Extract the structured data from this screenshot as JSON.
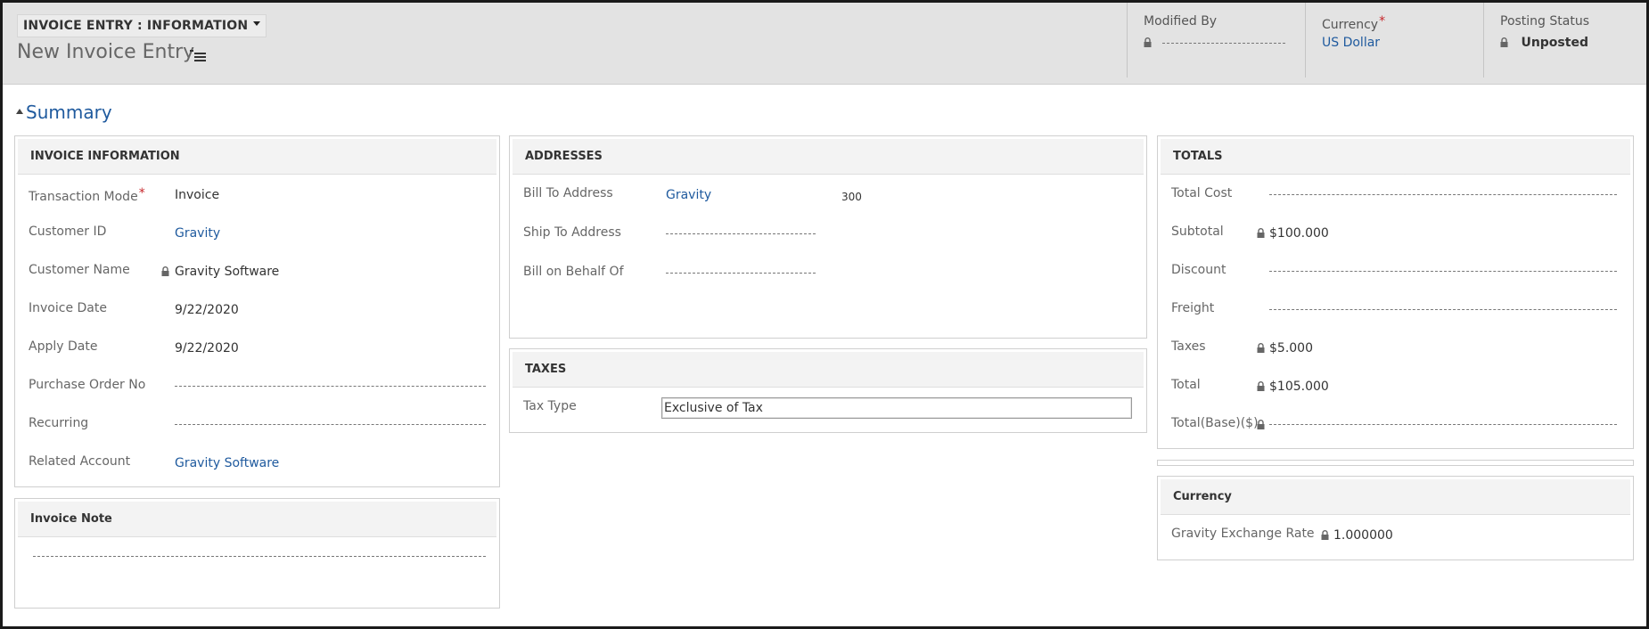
{
  "header": {
    "form_selector": "INVOICE ENTRY : INFORMATION",
    "title": "New Invoice Entry",
    "modified_by": {
      "label": "Modified By"
    },
    "currency": {
      "label": "Currency",
      "value": "US Dollar"
    },
    "posting_status": {
      "label": "Posting Status",
      "value": "Unposted"
    }
  },
  "summary": {
    "label": "Summary"
  },
  "invoice_information": {
    "title": "INVOICE INFORMATION",
    "fields": {
      "transaction_mode": {
        "label": "Transaction Mode",
        "value": "Invoice"
      },
      "customer_id": {
        "label": "Customer ID",
        "value": "Gravity"
      },
      "customer_name": {
        "label": "Customer Name",
        "value": "Gravity Software"
      },
      "invoice_date": {
        "label": "Invoice Date",
        "value": "9/22/2020"
      },
      "apply_date": {
        "label": "Apply Date",
        "value": "9/22/2020"
      },
      "purchase_order_no": {
        "label": "Purchase Order No"
      },
      "recurring": {
        "label": "Recurring"
      },
      "related_account": {
        "label": "Related Account",
        "value": "Gravity Software"
      }
    }
  },
  "invoice_note": {
    "title": "Invoice Note"
  },
  "addresses": {
    "title": "ADDRESSES",
    "bill_to": {
      "label": "Bill To Address",
      "value": "Gravity",
      "code": "300"
    },
    "ship_to": {
      "label": "Ship To Address"
    },
    "bill_on_behalf": {
      "label": "Bill on Behalf Of"
    }
  },
  "taxes": {
    "title": "TAXES",
    "tax_type": {
      "label": "Tax Type",
      "value": "Exclusive of Tax"
    }
  },
  "totals": {
    "title": "TOTALS",
    "total_cost": {
      "label": "Total Cost"
    },
    "subtotal": {
      "label": "Subtotal",
      "value": "$100.000"
    },
    "discount": {
      "label": "Discount"
    },
    "freight": {
      "label": "Freight"
    },
    "taxes": {
      "label": "Taxes",
      "value": "$5.000"
    },
    "total": {
      "label": "Total",
      "value": "$105.000"
    },
    "total_base": {
      "label": "Total(Base)($)"
    }
  },
  "currency_section": {
    "title": "Currency",
    "exchange_rate": {
      "label": "Gravity Exchange Rate",
      "value": "1.000000"
    }
  },
  "colors": {
    "link": "#1f5a9e",
    "required": "#c7262b",
    "header_bg": "#e3e3e3"
  }
}
